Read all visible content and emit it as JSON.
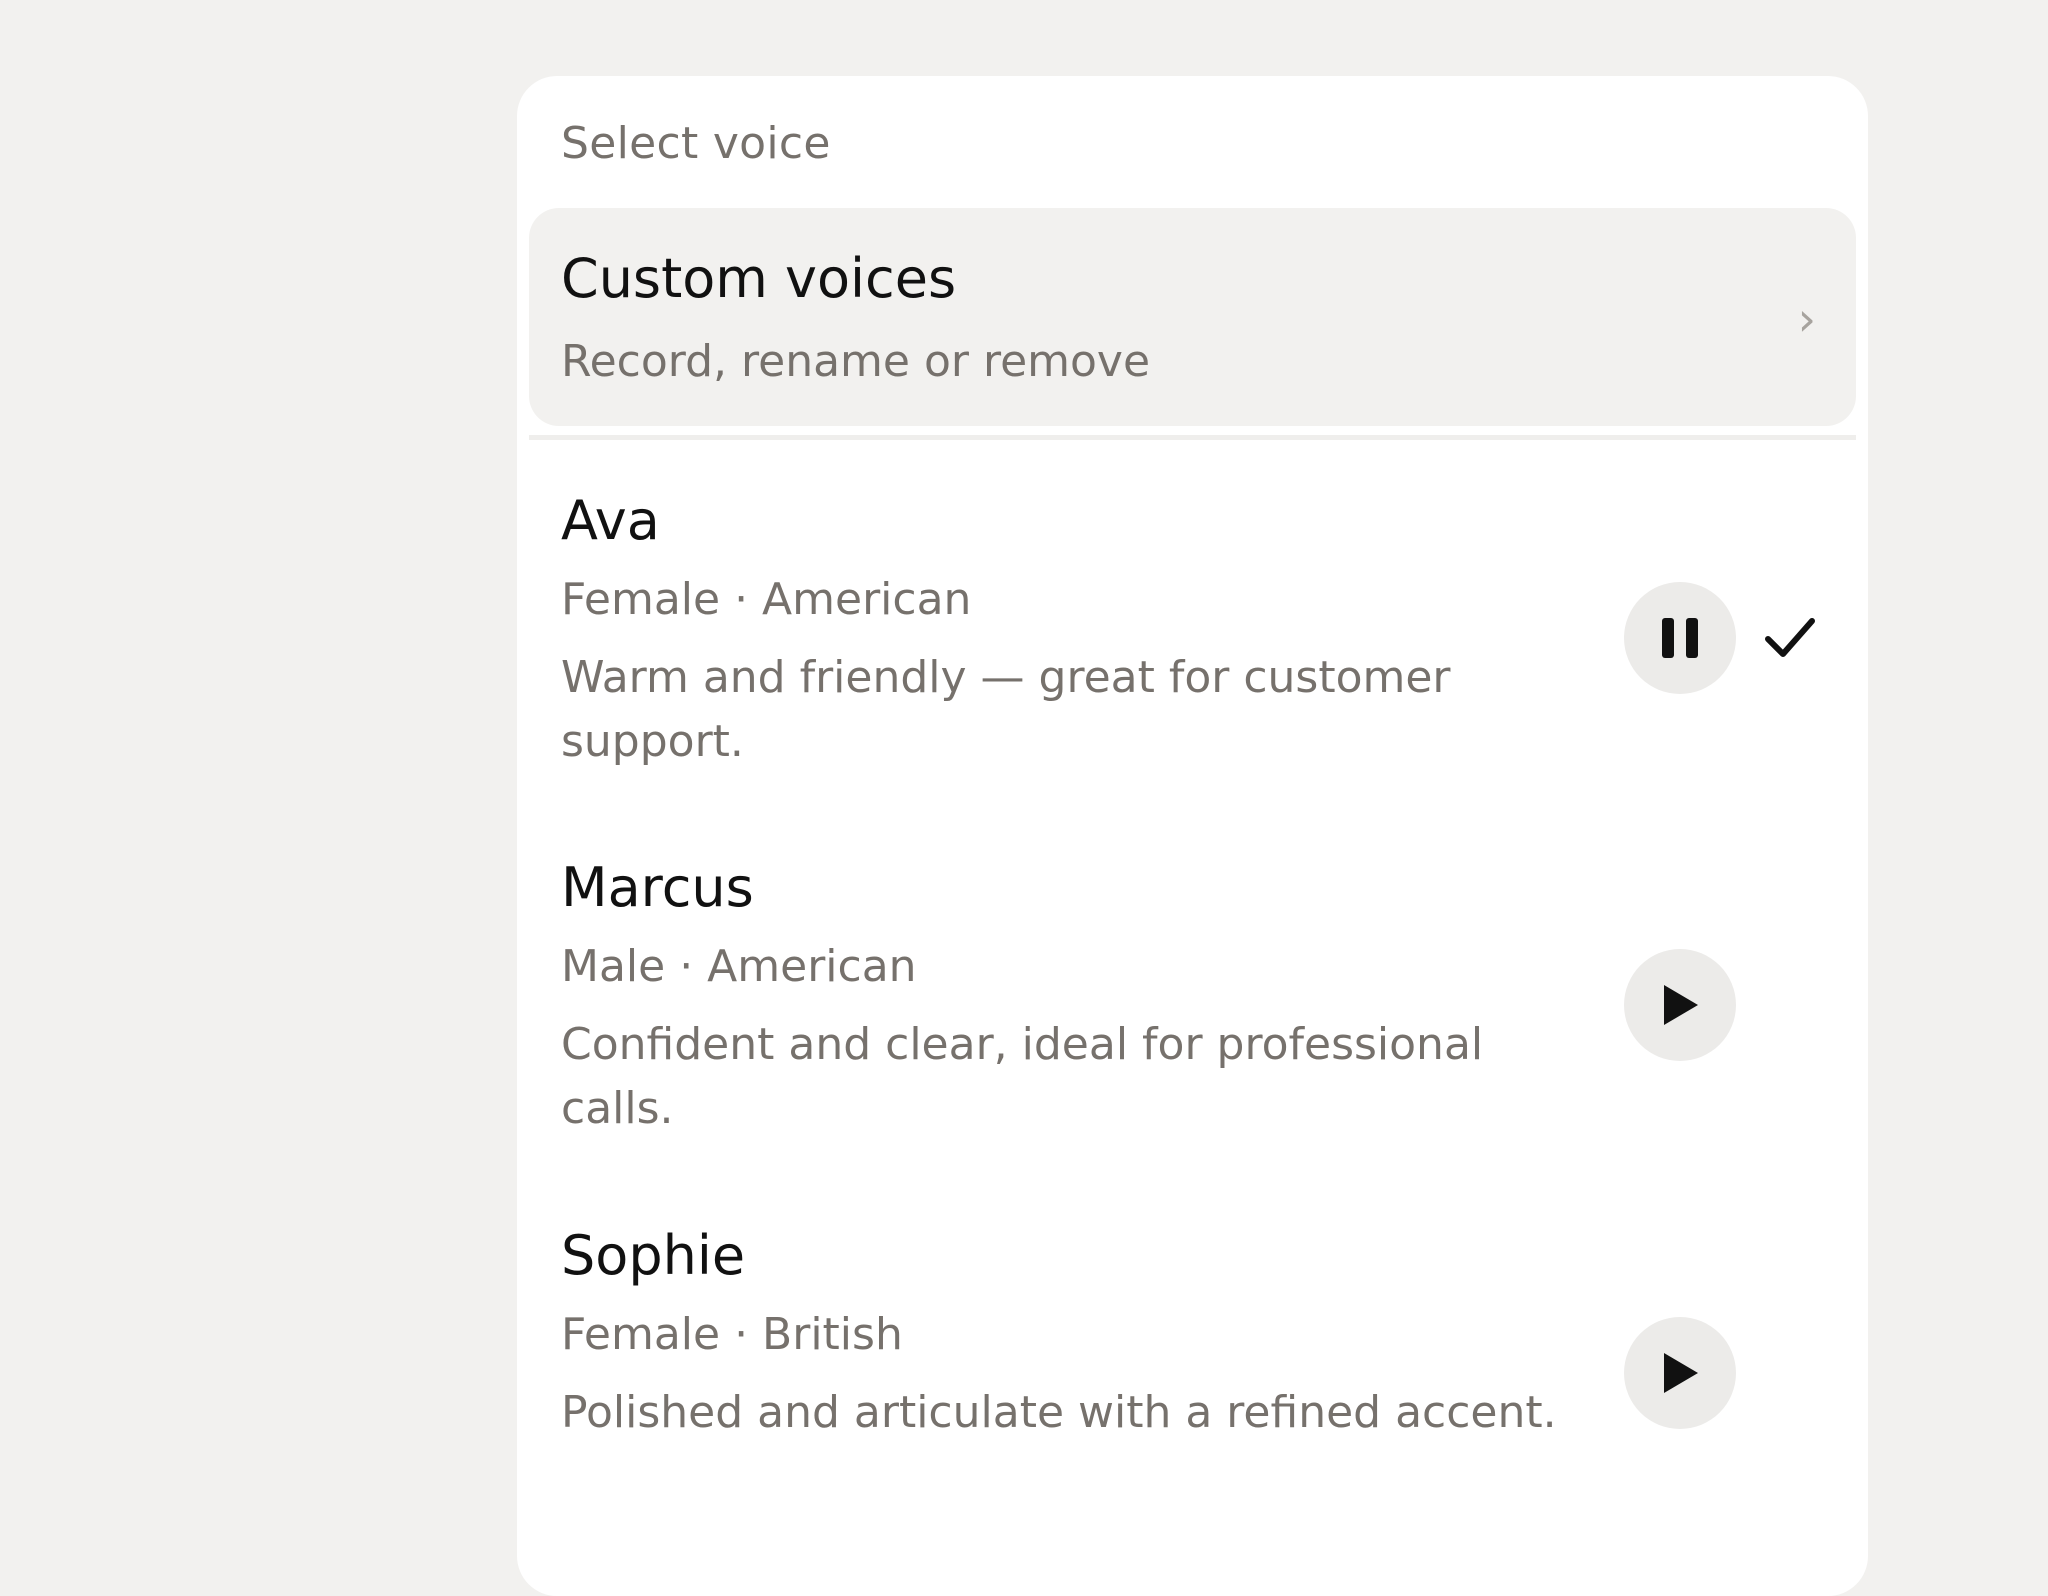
{
  "panel": {
    "title": "Select voice"
  },
  "custom_voices": {
    "title": "Custom voices",
    "subtitle": "Record, rename or remove",
    "chevron": "›"
  },
  "voices": [
    {
      "name": "Ava",
      "meta": "Female · American",
      "description": "Warm and friendly — great for customer support.",
      "playback": "pause-icon",
      "selected": true
    },
    {
      "name": "Marcus",
      "meta": "Male · American",
      "description": "Confident and clear, ideal for professional calls.",
      "playback": "play-icon",
      "selected": false
    },
    {
      "name": "Sophie",
      "meta": "Female · British",
      "description": "Polished and articulate with a refined accent.",
      "playback": "play-icon",
      "selected": false
    }
  ],
  "colors": {
    "background": "#f2f1ef",
    "panel": "#ffffff",
    "primary_text": "#111111",
    "secondary_text": "#76716c",
    "button_bg": "#ecebe9"
  }
}
